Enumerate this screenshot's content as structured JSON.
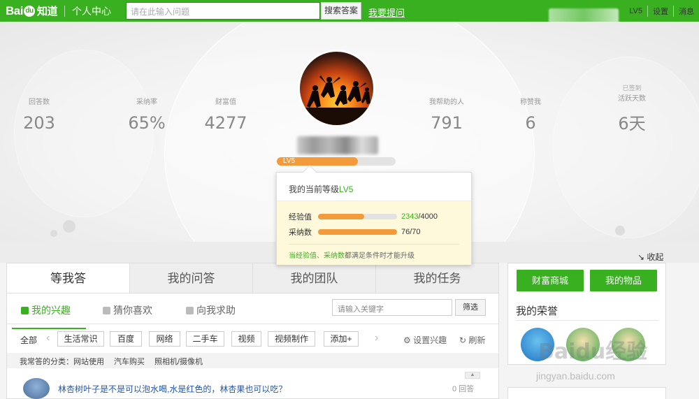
{
  "header": {
    "logo_text": "Bai",
    "logo_du": "du",
    "logo_zhidao": "知道",
    "user_center": "个人中心",
    "search_placeholder": "请在此输入问题",
    "search_button": "搜索答案",
    "ask_link": "我要提问",
    "level": "LV5",
    "settings": "设置",
    "messages": "消息"
  },
  "stats": {
    "answers": {
      "label": "回答数",
      "value": "203"
    },
    "adopt_rate": {
      "label": "采纳率",
      "value": "65%"
    },
    "wealth": {
      "label": "财富值",
      "value": "4277"
    },
    "helped": {
      "label": "我帮助的人",
      "value": "791"
    },
    "praised": {
      "label": "称赞我",
      "value": "6"
    },
    "active_days": {
      "sub": "已签到",
      "label": "活跃天数",
      "value": "6天"
    }
  },
  "profile": {
    "level_label": "LV5",
    "level_fill": 0.68,
    "collapse": "收起"
  },
  "tooltip": {
    "head_prefix": "我的当前等级",
    "head_level": "LV5",
    "exp_label": "经验值",
    "exp_current": "2343",
    "exp_total": "/4000",
    "exp_fill": 0.586,
    "adopt_label": "采纳数",
    "adopt_value": "76/70",
    "adopt_fill": 1.0,
    "note_prefix": "当",
    "note_exp": "经验值",
    "note_sep": "、",
    "note_adopt": "采纳数",
    "note_suffix": "都满足条件时才能升级"
  },
  "main": {
    "tabs": [
      "等我答",
      "我的问答",
      "我的团队",
      "我的任务"
    ],
    "subtabs": [
      "我的兴趣",
      "猜你喜欢",
      "向我求助"
    ],
    "keyword_placeholder": "请输入关键字",
    "filter_button": "筛选",
    "tag_all": "全部",
    "tags": [
      "生活常识",
      "百度",
      "网络",
      "二手车",
      "视频",
      "视频制作",
      "添加+"
    ],
    "set_interest": "设置兴趣",
    "refresh": "刷新",
    "categories_label": "我常答的分类：",
    "categories": [
      "网站使用",
      "汽车购买",
      "照相机/摄像机"
    ],
    "question_title": "林杏树叶子是不是可以泡水喝,水是红色的，林杏果也可以吃？",
    "question_count": "0 回答"
  },
  "sidebar": {
    "mall_button": "财富商城",
    "items_button": "我的物品",
    "honor_title": "我的荣誉"
  },
  "watermark": {
    "text": "Baidu经验",
    "url": "jingyan.baidu.com"
  }
}
